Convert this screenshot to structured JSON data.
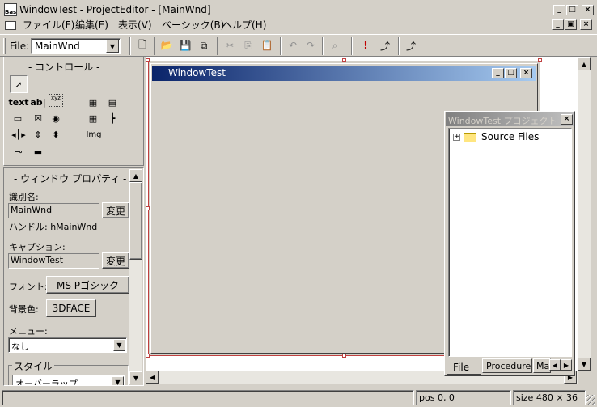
{
  "app": {
    "icon_text": "Bas",
    "title": "WindowTest - ProjectEditor - [MainWnd]"
  },
  "menu": {
    "items": [
      {
        "label": "ファイル(F)"
      },
      {
        "label": "編集(E)"
      },
      {
        "label": "表示(V)"
      },
      {
        "label": "ベーシック(B)"
      },
      {
        "label": "ヘルプ(H)"
      }
    ]
  },
  "toolbar": {
    "file_label": "File:",
    "file_value": "MainWnd"
  },
  "controls_panel": {
    "title": "- コントロール -",
    "text_label": "text",
    "edit_label": "ab|",
    "xyz_label": "xyz",
    "img_label": "Img"
  },
  "props": {
    "title": "- ウィンドウ プロパティ -",
    "id_label": "識別名:",
    "id_value": "MainWnd",
    "change_label": "変更",
    "handle_label": "ハンドル: hMainWnd",
    "caption_label": "キャプション:",
    "caption_value": "WindowTest",
    "font_label": "フォント:",
    "font_value": "MS Pゴシック",
    "bg_label": "背景色:",
    "bg_value": "3DFACE",
    "menu_label": "メニュー:",
    "menu_value": "なし",
    "style_label": "スタイル",
    "style_value": "オーバーラップ"
  },
  "design": {
    "window_title": "WindowTest"
  },
  "project": {
    "title": "WindowTest プロジェクト",
    "tree_item": "Source Files",
    "tabs": [
      {
        "label": "File"
      },
      {
        "label": "Procedure"
      },
      {
        "label": "Ma"
      }
    ]
  },
  "status": {
    "pos": "pos 0, 0",
    "size": "size 480 × 36"
  },
  "colors": {
    "titlebar_start": "#0a246a",
    "titlebar_end": "#a6caf0",
    "inactive_title": "#808080",
    "selection_handle": "#c04040",
    "desktop": "#d4d0c8"
  }
}
